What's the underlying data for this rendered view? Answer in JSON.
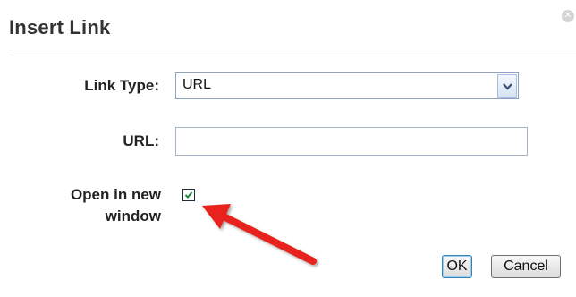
{
  "dialog": {
    "title": "Insert Link",
    "close_icon": "close-icon"
  },
  "form": {
    "link_type_label": "Link Type:",
    "link_type_value": "URL",
    "url_label": "URL:",
    "url_value": "",
    "new_window_label": "Open in new window",
    "new_window_checked": true
  },
  "buttons": {
    "ok_label": "OK",
    "cancel_label": "Cancel"
  },
  "annotation": {
    "arrow_color": "#e8211b",
    "arrow_icon": "red-arrow-icon"
  }
}
